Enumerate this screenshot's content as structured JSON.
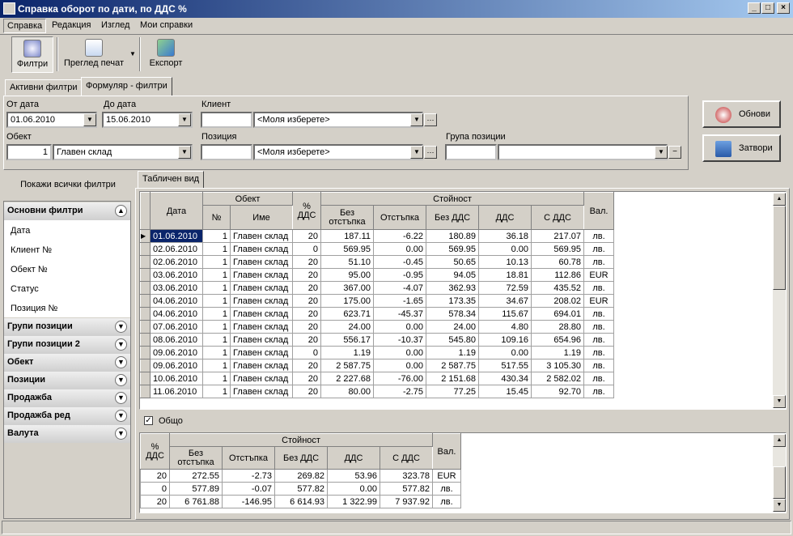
{
  "window": {
    "title": "Справка оборот по дати, по ДДС %",
    "min": "_",
    "max": "□",
    "close": "×"
  },
  "menu": [
    "Справка",
    "Редакция",
    "Изглед",
    "Мои справки"
  ],
  "toolbar": {
    "filters": "Филтри",
    "print_preview": "Преглед печат",
    "export": "Експорт"
  },
  "filter_tabs": [
    "Активни филтри",
    "Формуляр - филтри"
  ],
  "form": {
    "from_date_label": "От дата",
    "from_date": "01.06.2010",
    "to_date_label": "До дата",
    "to_date": "15.06.2010",
    "client_label": "Клиент",
    "client_code": "",
    "client_value": "<Моля изберете>",
    "object_label": "Обект",
    "object_code": "1",
    "object_value": "Главен склад",
    "position_label": "Позиция",
    "position_code": "",
    "position_value": "<Моля изберете>",
    "group_label": "Група позиции",
    "group_code": "",
    "group_value": ""
  },
  "buttons": {
    "refresh": "Обнови",
    "close": "Затвори",
    "show_all_filters": "Покажи всички филтри"
  },
  "filter_panel": {
    "main_header": "Основни филтри",
    "main_items": [
      "Дата",
      "Клиент №",
      "Обект №",
      "Статус",
      "Позиция №"
    ],
    "groups": [
      "Групи позиции",
      "Групи позиции 2",
      "Обект",
      "Позиции",
      "Продажба",
      "Продажба ред",
      "Валута"
    ]
  },
  "view_tab": "Табличен вид",
  "grid": {
    "headers": {
      "date": "Дата",
      "object": "Обект",
      "obj_no": "№",
      "obj_name": "Име",
      "vat_pct": "% ДДС",
      "value": "Стойност",
      "no_discount": "Без отстъпка",
      "discount": "Отстъпка",
      "no_vat": "Без ДДС",
      "vat": "ДДС",
      "with_vat": "С ДДС",
      "currency": "Вал."
    },
    "rows": [
      [
        "01.06.2010",
        "1",
        "Главен склад",
        "20",
        "187.11",
        "-6.22",
        "180.89",
        "36.18",
        "217.07",
        "лв."
      ],
      [
        "02.06.2010",
        "1",
        "Главен склад",
        "0",
        "569.95",
        "0.00",
        "569.95",
        "0.00",
        "569.95",
        "лв."
      ],
      [
        "02.06.2010",
        "1",
        "Главен склад",
        "20",
        "51.10",
        "-0.45",
        "50.65",
        "10.13",
        "60.78",
        "лв."
      ],
      [
        "03.06.2010",
        "1",
        "Главен склад",
        "20",
        "95.00",
        "-0.95",
        "94.05",
        "18.81",
        "112.86",
        "EUR"
      ],
      [
        "03.06.2010",
        "1",
        "Главен склад",
        "20",
        "367.00",
        "-4.07",
        "362.93",
        "72.59",
        "435.52",
        "лв."
      ],
      [
        "04.06.2010",
        "1",
        "Главен склад",
        "20",
        "175.00",
        "-1.65",
        "173.35",
        "34.67",
        "208.02",
        "EUR"
      ],
      [
        "04.06.2010",
        "1",
        "Главен склад",
        "20",
        "623.71",
        "-45.37",
        "578.34",
        "115.67",
        "694.01",
        "лв."
      ],
      [
        "07.06.2010",
        "1",
        "Главен склад",
        "20",
        "24.00",
        "0.00",
        "24.00",
        "4.80",
        "28.80",
        "лв."
      ],
      [
        "08.06.2010",
        "1",
        "Главен склад",
        "20",
        "556.17",
        "-10.37",
        "545.80",
        "109.16",
        "654.96",
        "лв."
      ],
      [
        "09.06.2010",
        "1",
        "Главен склад",
        "0",
        "1.19",
        "0.00",
        "1.19",
        "0.00",
        "1.19",
        "лв."
      ],
      [
        "09.06.2010",
        "1",
        "Главен склад",
        "20",
        "2 587.75",
        "0.00",
        "2 587.75",
        "517.55",
        "3 105.30",
        "лв."
      ],
      [
        "10.06.2010",
        "1",
        "Главен склад",
        "20",
        "2 227.68",
        "-76.00",
        "2 151.68",
        "430.34",
        "2 582.02",
        "лв."
      ],
      [
        "11.06.2010",
        "1",
        "Главен склад",
        "20",
        "80.00",
        "-2.75",
        "77.25",
        "15.45",
        "92.70",
        "лв."
      ]
    ]
  },
  "totals": {
    "checkbox_label": "Общо",
    "rows": [
      [
        "20",
        "272.55",
        "-2.73",
        "269.82",
        "53.96",
        "323.78",
        "EUR"
      ],
      [
        "0",
        "577.89",
        "-0.07",
        "577.82",
        "0.00",
        "577.82",
        "лв."
      ],
      [
        "20",
        "6 761.88",
        "-146.95",
        "6 614.93",
        "1 322.99",
        "7 937.92",
        "лв."
      ]
    ]
  }
}
